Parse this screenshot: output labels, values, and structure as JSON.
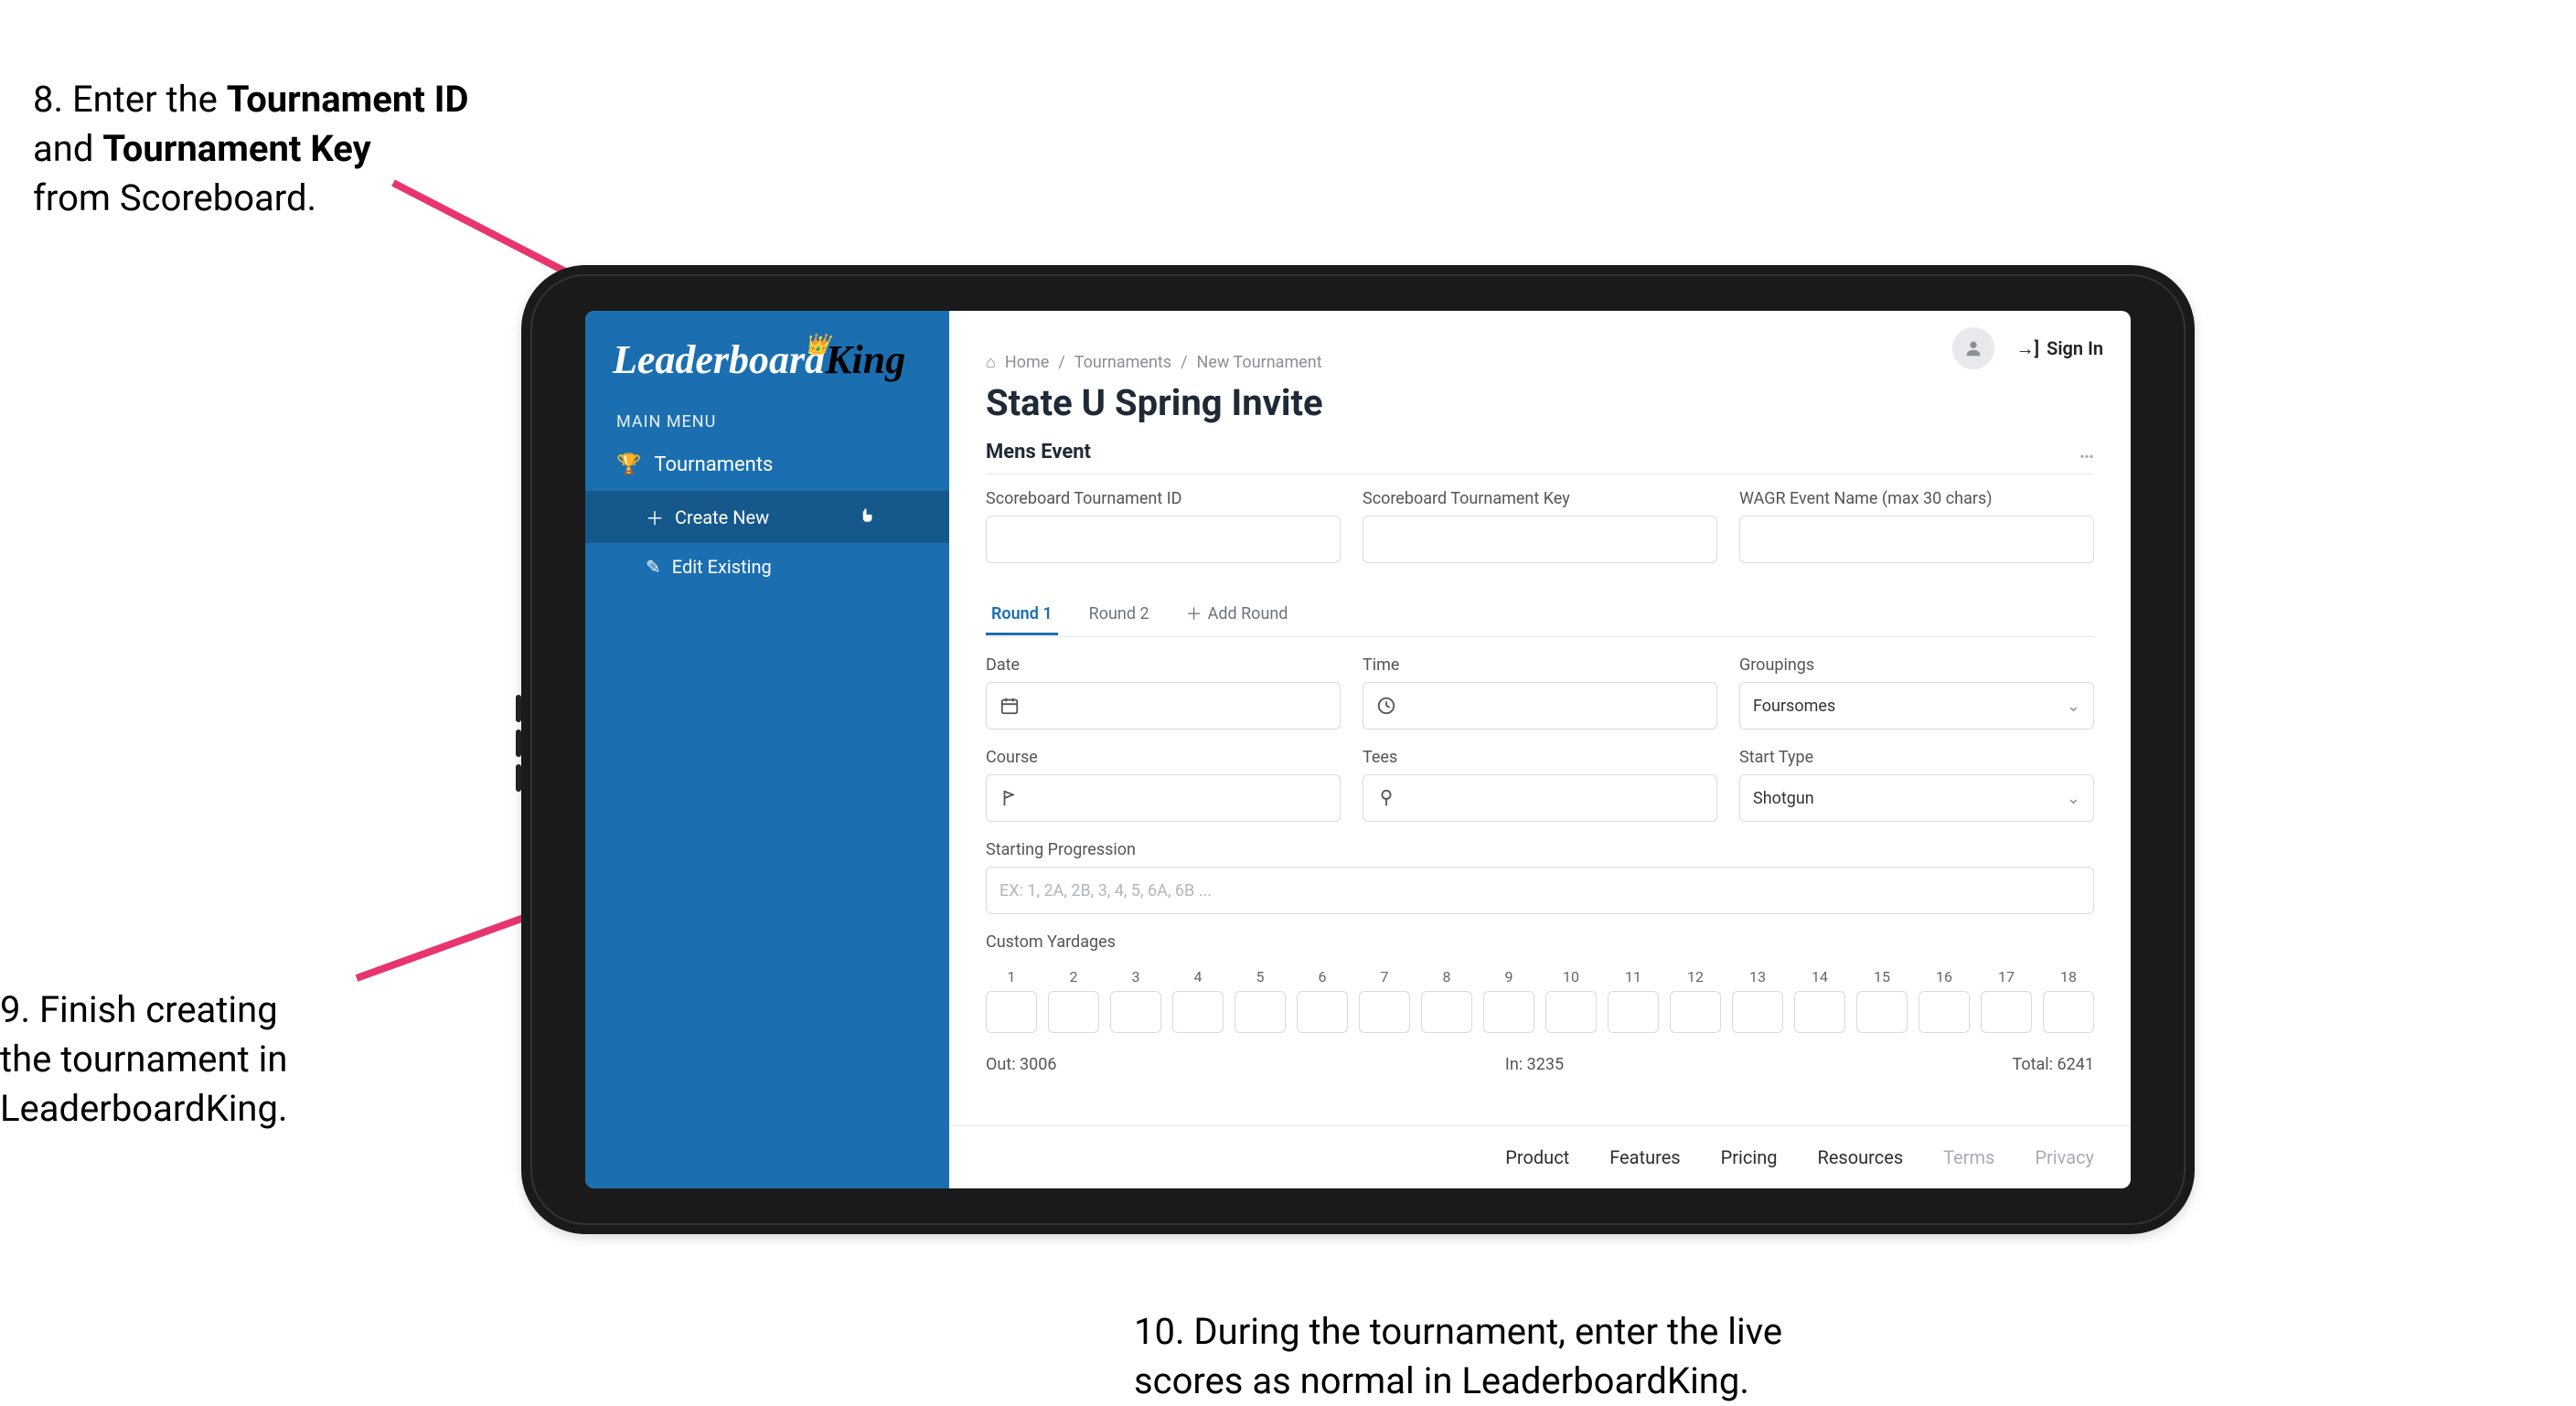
{
  "annotations": {
    "step8_pre": "8. Enter the ",
    "step8_b1": "Tournament ID",
    "step8_mid": "and ",
    "step8_b2": "Tournament Key",
    "step8_post": "from Scoreboard.",
    "step9_l1": "9. Finish creating",
    "step9_l2": "the tournament in",
    "step9_l3": "LeaderboardKing.",
    "step10_l1": "10. During the tournament, enter the live",
    "step10_l2": "scores as normal in LeaderboardKing."
  },
  "sidebar": {
    "logo_leaderboard": "Leaderboard",
    "logo_king": "King",
    "menu_label": "MAIN MENU",
    "item_tournaments": "Tournaments",
    "sub_create": "Create New",
    "sub_edit": "Edit Existing"
  },
  "topbar": {
    "signin": "Sign In"
  },
  "breadcrumb": {
    "home": "Home",
    "tournaments": "Tournaments",
    "new": "New Tournament"
  },
  "page_title": "State U Spring Invite",
  "section_title": "Mens Event",
  "section_more": "…",
  "fields": {
    "scoreboard_id_label": "Scoreboard Tournament ID",
    "scoreboard_key_label": "Scoreboard Tournament Key",
    "wagr_label": "WAGR Event Name (max 30 chars)",
    "date_label": "Date",
    "time_label": "Time",
    "groupings_label": "Groupings",
    "groupings_value": "Foursomes",
    "course_label": "Course",
    "tees_label": "Tees",
    "start_type_label": "Start Type",
    "start_type_value": "Shotgun",
    "starting_prog_label": "Starting Progression",
    "starting_prog_placeholder": "EX: 1, 2A, 2B, 3, 4, 5, 6A, 6B ...",
    "custom_yardages_label": "Custom Yardages"
  },
  "tabs": {
    "round1": "Round 1",
    "round2": "Round 2",
    "add_round": "Add Round"
  },
  "yardage": {
    "holes": [
      "1",
      "2",
      "3",
      "4",
      "5",
      "6",
      "7",
      "8",
      "9",
      "10",
      "11",
      "12",
      "13",
      "14",
      "15",
      "16",
      "17",
      "18"
    ],
    "out_label": "Out:",
    "out_value": "3006",
    "in_label": "In:",
    "in_value": "3235",
    "total_label": "Total:",
    "total_value": "6241"
  },
  "footer": {
    "product": "Product",
    "features": "Features",
    "pricing": "Pricing",
    "resources": "Resources",
    "terms": "Terms",
    "privacy": "Privacy"
  }
}
